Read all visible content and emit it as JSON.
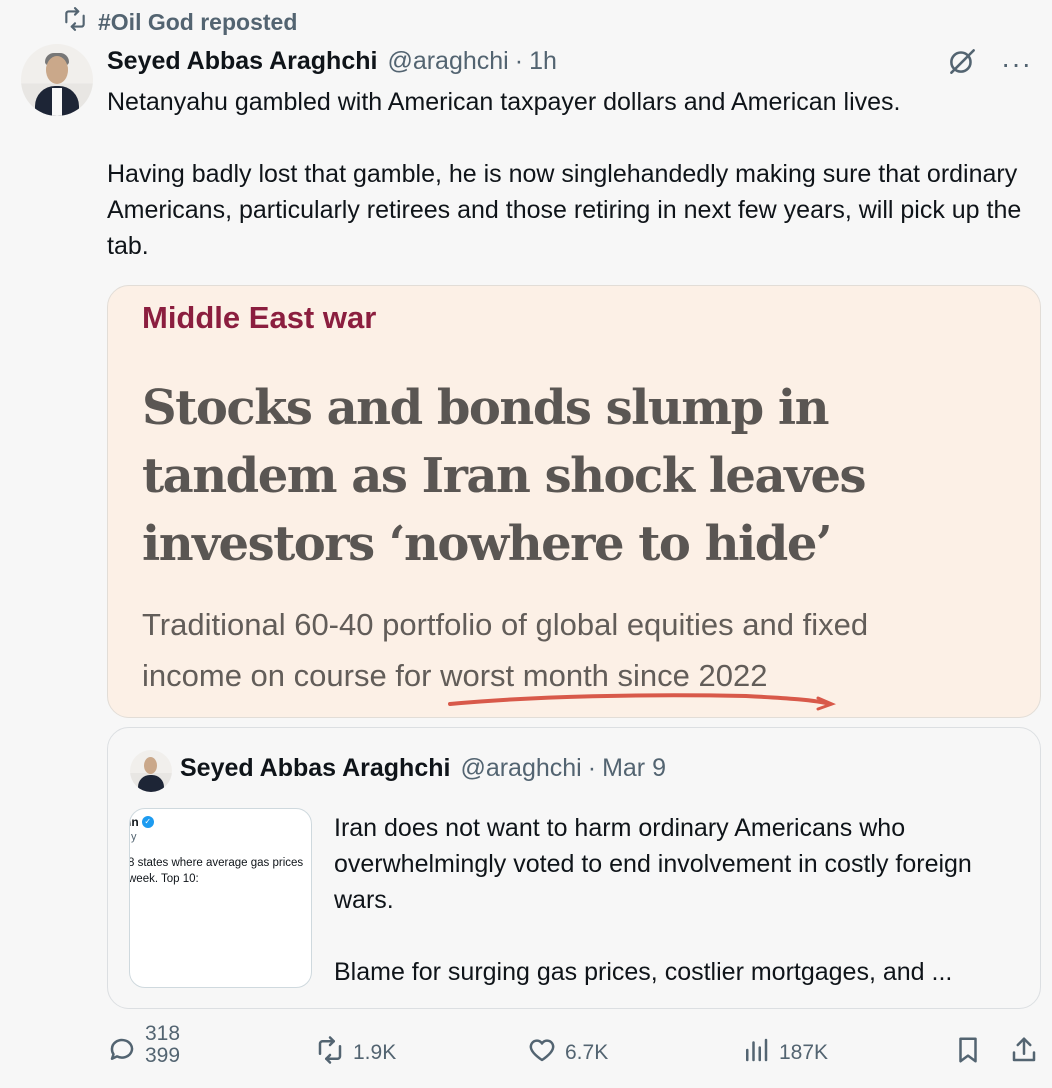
{
  "repost": {
    "label": "#Oil God reposted"
  },
  "tweet": {
    "author_name": "Seyed Abbas Araghchi",
    "handle": "@araghchi",
    "separator": "·",
    "time": "1h",
    "more_label": "···",
    "paragraphs": [
      "Netanyahu gambled with American taxpayer dollars and American lives.",
      "Having badly lost that gamble, he is now singlehandedly making sure that ordinary Americans, particularly retirees and those retiring in next few years, will pick up the tab."
    ]
  },
  "article_card": {
    "section": "Middle East war",
    "headline_lines": [
      "Stocks and bonds slump in",
      "tandem as Iran shock leaves",
      "investors ‘nowhere to hide’"
    ],
    "subhead_lines": [
      "Traditional 60-40 portfolio of global equities and fixed",
      "income on course for worst month since 2022"
    ],
    "colors": {
      "background": "#fcf0e6",
      "section": "#8b1e3f",
      "underline": "#d8594a"
    }
  },
  "quoted_tweet": {
    "author_name": "Seyed Abbas Araghchi",
    "handle": "@araghchi",
    "separator": "·",
    "date": "Mar 9",
    "media": {
      "name_fragment": "ın",
      "sub_fragment": "ıy",
      "text_line_1": "8 states where average gas prices",
      "text_line_2": "week. Top 10:"
    },
    "paragraphs": [
      "Iran does not want to harm ordinary Americans who overwhelmingly voted to end involvement in costly foreign wars.",
      "Blame for surging gas prices, costlier mortgages, and ..."
    ]
  },
  "actions": {
    "replies_top": "318",
    "replies_bottom": "399",
    "reposts": "1.9K",
    "likes": "6.7K",
    "views": "187K"
  }
}
